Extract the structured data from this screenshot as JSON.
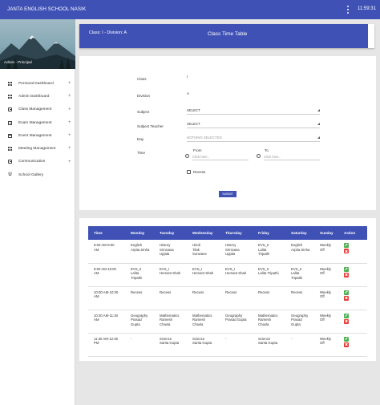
{
  "app": {
    "title": "JANTA ENGLISH SCHOOL NASIK",
    "time": "11:59:31"
  },
  "sidebar": {
    "user": "Admin - Principal",
    "items": [
      {
        "label": "Personal Dashboard",
        "icon": "grid-icon",
        "expand": "+"
      },
      {
        "label": "Admin Dashboard",
        "icon": "grid-icon",
        "expand": "+"
      },
      {
        "label": "Class Management",
        "icon": "class-icon",
        "expand": "+"
      },
      {
        "label": "Exam Management",
        "icon": "exam-icon",
        "expand": "+"
      },
      {
        "label": "Event Management",
        "icon": "calendar-icon",
        "expand": "+"
      },
      {
        "label": "Meeting Management",
        "icon": "meeting-icon",
        "expand": "+"
      },
      {
        "label": "Communication",
        "icon": "message-icon",
        "expand": "+"
      },
      {
        "label": "School Gallery",
        "icon": "gallery-icon",
        "expand": ""
      }
    ]
  },
  "header": {
    "class_division": "Class: I - Division: A",
    "title": "Class Time Table"
  },
  "form": {
    "class_label": "Class",
    "class_value": "I",
    "division_label": "Division",
    "division_value": "A",
    "subject_label": "Subject",
    "subject_value": "SELECT",
    "teacher_label": "Subject Teacher",
    "teacher_value": "SELECT",
    "day_label": "Day",
    "day_value": "NOTHING SELECTED",
    "time_label": "Time",
    "from_label": "From",
    "from_placeholder": "Click here..",
    "to_label": "To",
    "to_placeholder": "Click here..",
    "recess_label": "Recess",
    "submit_label": "SUBMIT"
  },
  "table": {
    "headers": [
      "Time",
      "Monday",
      "Tuesday",
      "Wednesday",
      "Thursday",
      "Friday",
      "Saturday",
      "Sunday",
      "Action"
    ],
    "rows": [
      {
        "time": [
          "9:00 AM-9:00",
          "AM"
        ],
        "mon": [
          "English",
          "Arpita Sinha"
        ],
        "tue": [
          "History",
          "Srinivasa",
          "Upjala"
        ],
        "wed": [
          "Hindi",
          "Tilak",
          "Sonwane"
        ],
        "thu": [
          "History",
          "Srinivasa",
          "Upjala"
        ],
        "fri": [
          "EVS_II",
          "Lalita",
          "Tripathi"
        ],
        "sat": [
          "English",
          "Arpita Sinha"
        ],
        "sun": [
          "Weekly",
          "Off"
        ]
      },
      {
        "time": [
          "9:00 AM-10:00",
          "AM"
        ],
        "mon": [
          "EVS_II",
          "Lalita",
          "Tripathi"
        ],
        "tue": [
          "EVS_I",
          "Hemant Shah"
        ],
        "wed": [
          "EVS_I",
          "Hemant Shah"
        ],
        "thu": [
          "EVS_I",
          "Hemant Shah"
        ],
        "fri": [
          "EVS_II",
          "Lalita Tripathi"
        ],
        "sat": [
          "EVS_II",
          "Lalita",
          "Tripathi"
        ],
        "sun": [
          "Weekly",
          "Off"
        ]
      },
      {
        "time": [
          "10:00 AM-10:30",
          "AM"
        ],
        "mon": [
          "Recess"
        ],
        "tue": [
          "Recess"
        ],
        "wed": [
          "Recess"
        ],
        "thu": [
          "Recess"
        ],
        "fri": [
          "Recess"
        ],
        "sat": [
          "Recess"
        ],
        "sun": [
          "Weekly",
          "Off"
        ]
      },
      {
        "time": [
          "10:30 AM-11:30",
          "AM"
        ],
        "mon": [
          "Geography",
          "Prasad",
          "Gupta"
        ],
        "tue": [
          "Mathematics",
          "Ramesh",
          "Chavla"
        ],
        "wed": [
          "Mathematics",
          "Ramesh",
          "Chavla"
        ],
        "thu": [
          "Geography",
          "Prasad Gupta"
        ],
        "fri": [
          "Mathematics",
          "Ramesh",
          "Chavla"
        ],
        "sat": [
          "Geography",
          "Prasad",
          "Gupta"
        ],
        "sun": [
          "Weekly",
          "Off"
        ]
      },
      {
        "time": [
          "11:30 AM-12:30",
          "PM"
        ],
        "mon": [
          "-"
        ],
        "tue": [
          "Science",
          "Sarita Gupta"
        ],
        "wed": [
          "Science",
          "Sarita Gupta"
        ],
        "thu": [
          "-"
        ],
        "fri": [
          "Science",
          "Sarita Gupta"
        ],
        "sat": [
          "-"
        ],
        "sun": [
          "Weekly",
          "Off"
        ]
      }
    ]
  },
  "colors": {
    "primary": "#3f51b5",
    "edit": "#4caf50",
    "delete": "#e53935"
  }
}
